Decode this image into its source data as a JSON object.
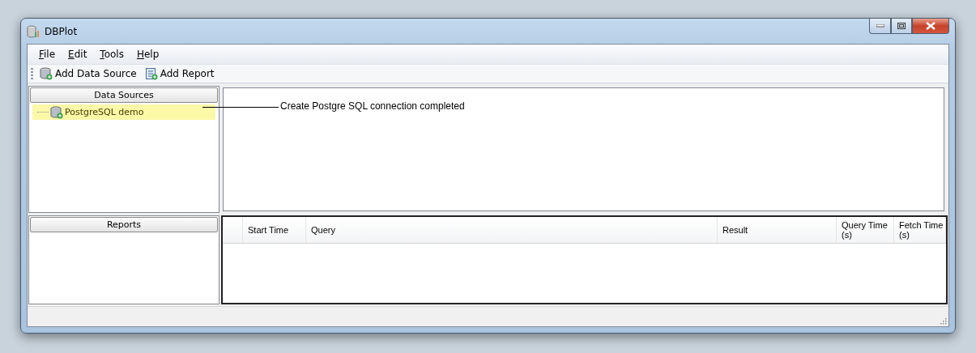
{
  "window": {
    "title": "DBPlot"
  },
  "menu": [
    {
      "label": "File"
    },
    {
      "label": "Edit"
    },
    {
      "label": "Tools"
    },
    {
      "label": "Help"
    }
  ],
  "toolbar": [
    {
      "label": "Add Data Source",
      "kind": "datasource"
    },
    {
      "label": "Add Report",
      "kind": "report"
    }
  ],
  "data_sources": {
    "title": "Data Sources",
    "items": [
      {
        "label": "PostgreSQL demo",
        "selected": true
      }
    ]
  },
  "reports": {
    "title": "Reports"
  },
  "log": {
    "message": "Create Postgre SQL connection completed"
  },
  "table": {
    "columns": [
      "Start Time",
      "Query",
      "Result",
      "Query Time (s)",
      "Fetch Time (s)"
    ]
  }
}
